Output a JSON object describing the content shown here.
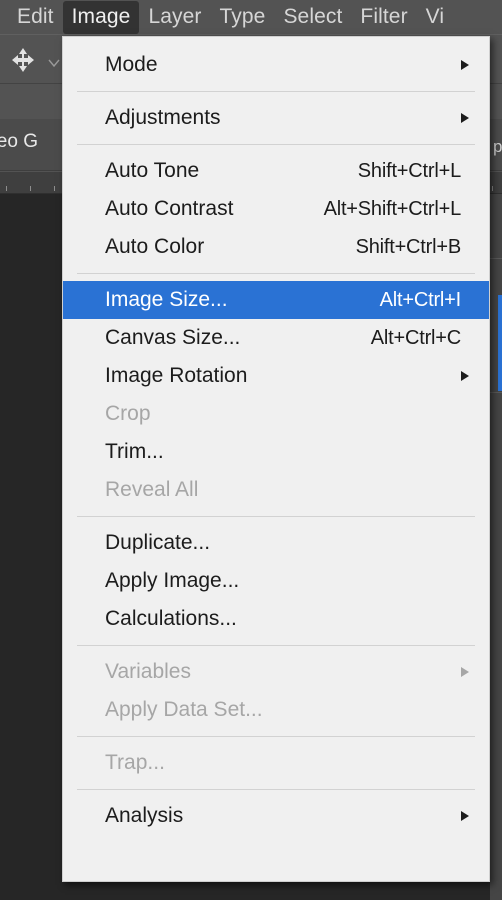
{
  "menubar": {
    "items": [
      {
        "label": "Edit",
        "active": false
      },
      {
        "label": "Image",
        "active": true
      },
      {
        "label": "Layer",
        "active": false
      },
      {
        "label": "Type",
        "active": false
      },
      {
        "label": "Select",
        "active": false
      },
      {
        "label": "Filter",
        "active": false
      },
      {
        "label": "Vi",
        "active": false
      }
    ]
  },
  "workspace": {
    "move_tool_icon": "move-tool-icon",
    "options_chevron_icon": "chevron-down-icon",
    "video_group_label": "ideo G",
    "right_panel_label": "p"
  },
  "menu": {
    "title": "Image",
    "selection_color": "#2a72d4",
    "groups": [
      {
        "items": [
          {
            "label": "Mode",
            "shortcut": "",
            "submenu": true,
            "disabled": false,
            "selected": false
          }
        ]
      },
      {
        "items": [
          {
            "label": "Adjustments",
            "shortcut": "",
            "submenu": true,
            "disabled": false,
            "selected": false
          }
        ]
      },
      {
        "items": [
          {
            "label": "Auto Tone",
            "shortcut": "Shift+Ctrl+L",
            "submenu": false,
            "disabled": false,
            "selected": false
          },
          {
            "label": "Auto Contrast",
            "shortcut": "Alt+Shift+Ctrl+L",
            "submenu": false,
            "disabled": false,
            "selected": false
          },
          {
            "label": "Auto Color",
            "shortcut": "Shift+Ctrl+B",
            "submenu": false,
            "disabled": false,
            "selected": false
          }
        ]
      },
      {
        "items": [
          {
            "label": "Image Size...",
            "shortcut": "Alt+Ctrl+I",
            "submenu": false,
            "disabled": false,
            "selected": true
          },
          {
            "label": "Canvas Size...",
            "shortcut": "Alt+Ctrl+C",
            "submenu": false,
            "disabled": false,
            "selected": false
          },
          {
            "label": "Image Rotation",
            "shortcut": "",
            "submenu": true,
            "disabled": false,
            "selected": false
          },
          {
            "label": "Crop",
            "shortcut": "",
            "submenu": false,
            "disabled": true,
            "selected": false
          },
          {
            "label": "Trim...",
            "shortcut": "",
            "submenu": false,
            "disabled": false,
            "selected": false
          },
          {
            "label": "Reveal All",
            "shortcut": "",
            "submenu": false,
            "disabled": true,
            "selected": false
          }
        ]
      },
      {
        "items": [
          {
            "label": "Duplicate...",
            "shortcut": "",
            "submenu": false,
            "disabled": false,
            "selected": false
          },
          {
            "label": "Apply Image...",
            "shortcut": "",
            "submenu": false,
            "disabled": false,
            "selected": false
          },
          {
            "label": "Calculations...",
            "shortcut": "",
            "submenu": false,
            "disabled": false,
            "selected": false
          }
        ]
      },
      {
        "items": [
          {
            "label": "Variables",
            "shortcut": "",
            "submenu": true,
            "disabled": true,
            "selected": false
          },
          {
            "label": "Apply Data Set...",
            "shortcut": "",
            "submenu": false,
            "disabled": true,
            "selected": false
          }
        ]
      },
      {
        "items": [
          {
            "label": "Trap...",
            "shortcut": "",
            "submenu": false,
            "disabled": true,
            "selected": false
          }
        ]
      },
      {
        "items": [
          {
            "label": "Analysis",
            "shortcut": "",
            "submenu": true,
            "disabled": false,
            "selected": false
          }
        ]
      }
    ]
  }
}
